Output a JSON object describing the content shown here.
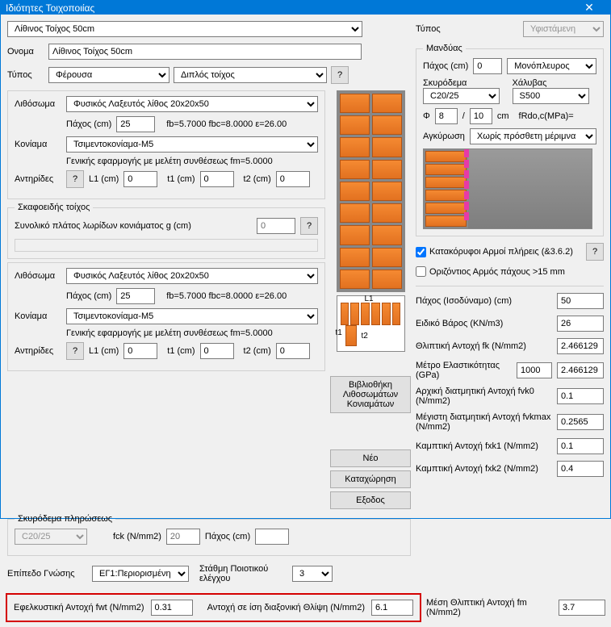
{
  "window_title": "Ιδιότητες Τοιχοποιίας",
  "top": {
    "wall_select": "Λίθινος Τοίχος 50cm"
  },
  "labels": {
    "onoma": "Ονομα",
    "typos": "Τύπος",
    "lithosoma": "Λιθόσωμα",
    "paxos_cm": "Πάχος (cm)",
    "koniama": "Κονίαμα",
    "antirides": "Αντηρίδες",
    "l1": "L1 (cm)",
    "t1": "t1 (cm)",
    "t2": "t2 (cm)",
    "skafo_legend": "Σκαφοειδής τοίχος",
    "skafo_label": "Συνολικό πλάτος λωρίδων κονιάματος g (cm)",
    "question": "?",
    "fb_note": "fb=5.7000 fbc=8.0000 ε=26.00",
    "koniama_note": "Γενικής εφαρμογής με μελέτη συνθέσεως fm=5.0000",
    "fill_concrete": "Σκυρόδεμα πληρώσεως",
    "fck": "fck (N/mm2)",
    "epipedo": "Επίπεδο Γνώσης",
    "stathmi": "Στάθμη Ποιοτικού ελέγχου",
    "lib_btn": "Βιβλιοθήκη\nΛιθοσωμάτων\nΚονιαμάτων",
    "neo": "Νέο",
    "kataxorisi": "Καταχώρηση",
    "exodos": "Εξοδος",
    "efelk": "Εφελκυστική Αντοχή fwt (N/mm2)",
    "antoxi_diax": "Αντοχή σε ίση διαξονική Θλίψη (N/mm2)",
    "t1m": "t1",
    "t2m": "t2",
    "L1m": "L1"
  },
  "values": {
    "onoma": "Λίθινος Τοίχος 50cm",
    "typos1": "Φέρουσα",
    "typos2": "Διπλός τοίχος",
    "litho1": "Φυσικός Λαξευτός λίθος 20x20x50",
    "paxos1": "25",
    "koniama1": "Τσιμεντοκονίαμα-M5",
    "l1_1": "0",
    "t1_1": "0",
    "t2_1": "0",
    "skafo_g": "0",
    "litho2": "Φυσικός Λαξευτός λίθος 20x20x50",
    "paxos2": "25",
    "koniama2": "Τσιμεντοκονίαμα-M5",
    "l1_2": "0",
    "t1_2": "0",
    "t2_2": "0",
    "fill_conc": "C20/25",
    "fill_fck": "20",
    "fill_paxos": "",
    "epipedo": "ΕΓ1:Περιορισμένη",
    "stathmi": "3",
    "efelk": "0.31",
    "antoxi_diax": "6.1"
  },
  "right": {
    "typos_label": "Τύπος",
    "typos_val": "Υφιστάμενη",
    "manduas": "Μανδύας",
    "paxos_label": "Πάχος (cm)",
    "paxos_val": "0",
    "side": "Μονόπλευρος",
    "skyrodema": "Σκυρόδεμα",
    "skyrodema_val": "C20/25",
    "xalivas": "Χάλυβας",
    "xalivas_val": "S500",
    "phi_label": "Φ",
    "phi_val": "8",
    "slash": "/",
    "phi_spacing": "10",
    "cm": "cm",
    "frdo": "fRdo,c(MPa)=",
    "agkyrosi": "Αγκύρωση",
    "agkyrosi_val": "Χωρίς πρόσθετη μέριμνα",
    "chk1": "Κατακόρυφοι Αρμοί πλήρεις (&3.6.2)",
    "chk1_checked": true,
    "chk2": "Οριζόντιος Αρμός πάχους >15 mm",
    "chk2_checked": false,
    "p_iso": "Πάχος (Ισοδύναμο) (cm)",
    "p_iso_v": "50",
    "eidiko": "Ειδικό Βάρος (KN/m3)",
    "eidiko_v": "26",
    "thlip": "Θλιπτική Αντοχή fk (N/mm2)",
    "thlip_v": "2.466129",
    "metro": "Μέτρο Ελαστικότητας (GPa)",
    "metro_v1": "1000",
    "metro_v2": "2.466129",
    "arxiki": "Αρχική διατμητική Αντοχή fvk0 (N/mm2)",
    "arxiki_v": "0.1",
    "megisti": "Μέγιστη διατμητική Αντοχή fvkmax (N/mm2)",
    "megisti_v": "0.2565",
    "kamp1": "Καμπτική Αντοχή  fxk1 (N/mm2)",
    "kamp1_v": "0.1",
    "kamp2": "Καμπτική Αντοχή  fxk2 (N/mm2)",
    "kamp2_v": "0.4",
    "mesi": "Μέση Θλιπτική Αντοχή fm (N/mm2)",
    "mesi_v": "3.7"
  }
}
